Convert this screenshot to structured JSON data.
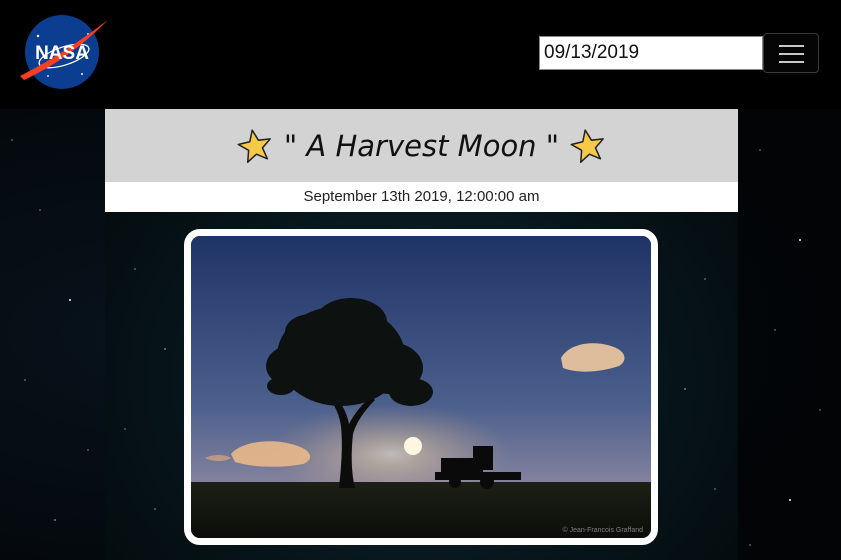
{
  "header": {
    "logo_text": "NASA",
    "date_input_value": "09/13/2019",
    "menu_toggle_icon": "hamburger-icon"
  },
  "apod": {
    "title": "A Harvest Moon",
    "title_quote_left": "\"",
    "title_quote_right": "\"",
    "title_icon": "star-icon",
    "date": "September 13th 2019, 12:00:00 am",
    "image_credit": "© Jean-Francois Graffand"
  },
  "colors": {
    "header_bg": "#000000",
    "title_bar_bg": "#d3d3d3",
    "star_fill": "#f7c948",
    "nasa_blue": "#0b3d91",
    "nasa_red": "#fc3d21"
  }
}
